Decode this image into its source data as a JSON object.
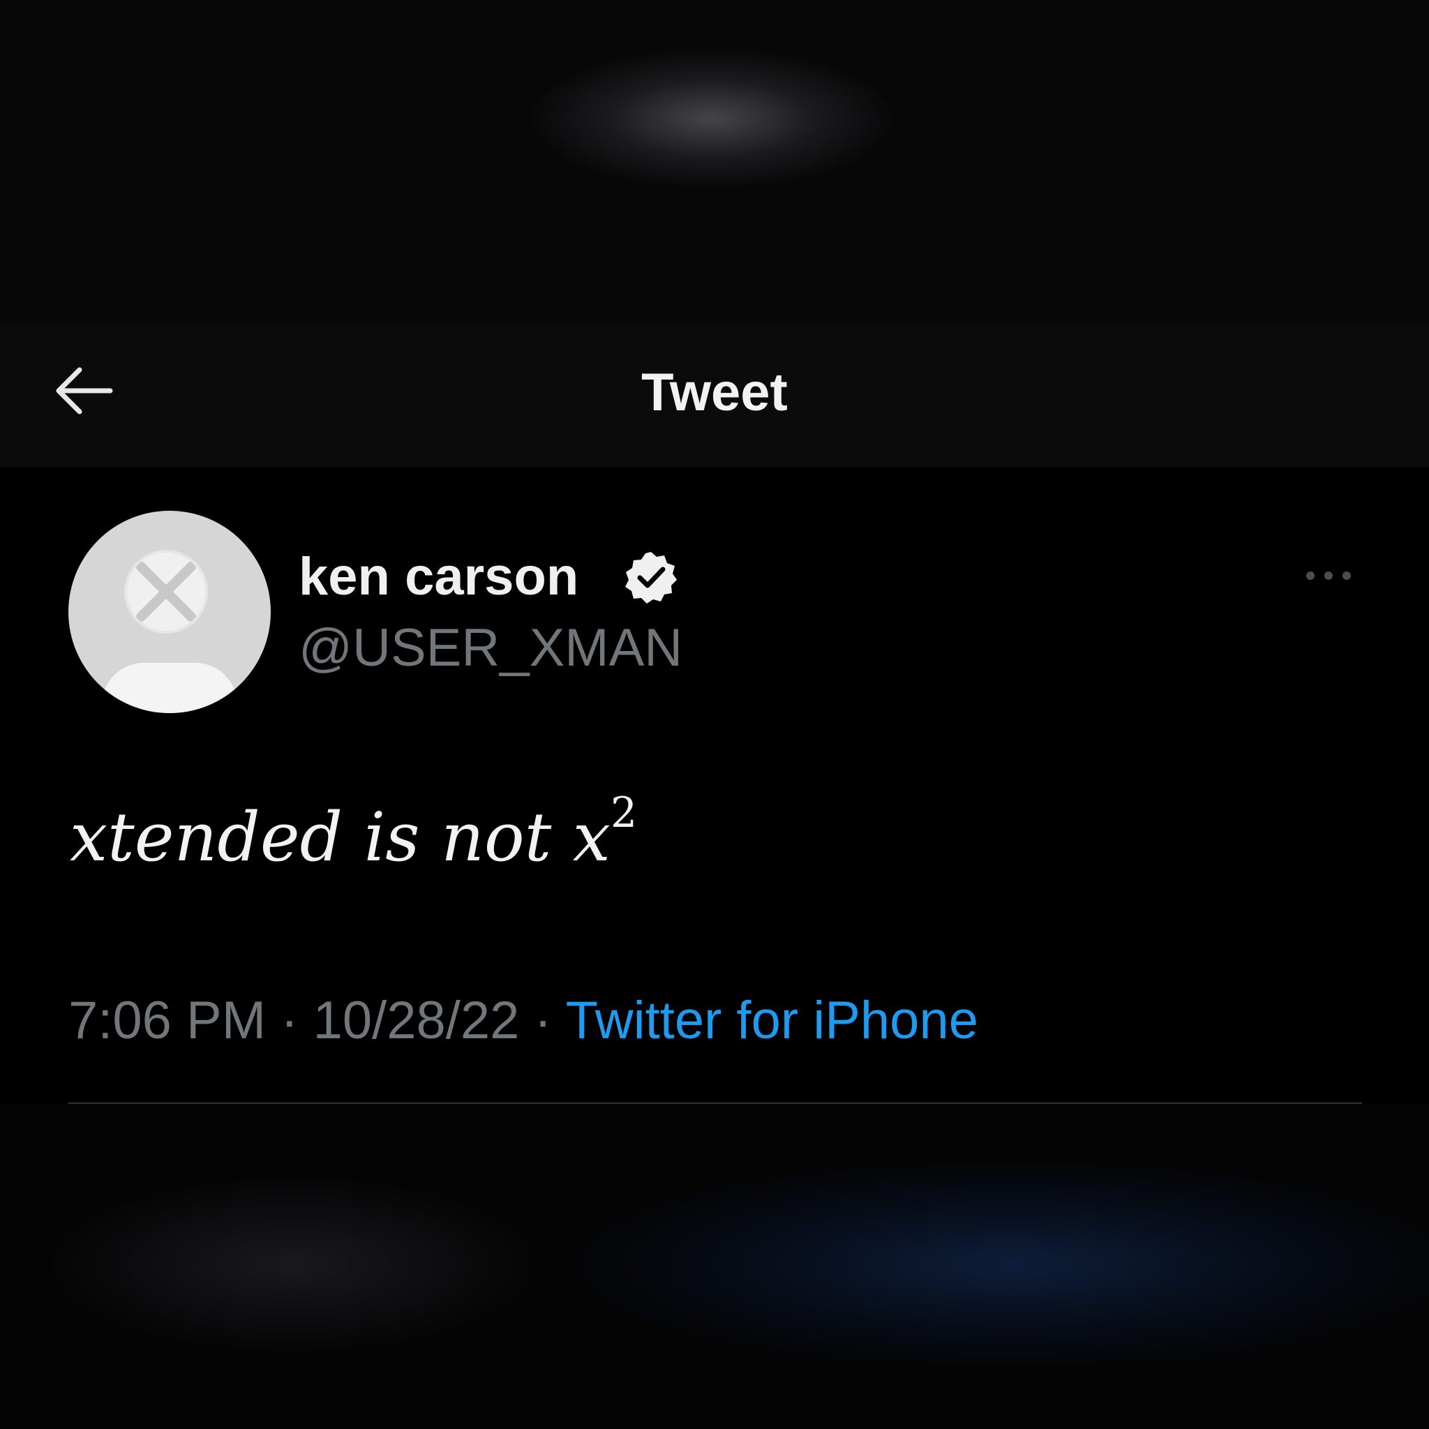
{
  "header": {
    "title": "Tweet",
    "back_icon": "arrow-left-icon"
  },
  "tweet": {
    "display_name": "ken carson",
    "verified_icon": "verified-badge-icon",
    "handle": "@USER_XMAN",
    "more_icon": "more-dots-icon",
    "text_main": "xtended is not x",
    "text_superscript": "2",
    "time": "7:06 PM",
    "separator": " · ",
    "date": "10/28/22",
    "source": "Twitter for iPhone"
  },
  "colors": {
    "background": "#000000",
    "header_background": "#0b0b0c",
    "primary_text": "#f0f0f0",
    "secondary_text": "#71767b",
    "link": "#1d9bf0",
    "divider": "#2f3336"
  }
}
